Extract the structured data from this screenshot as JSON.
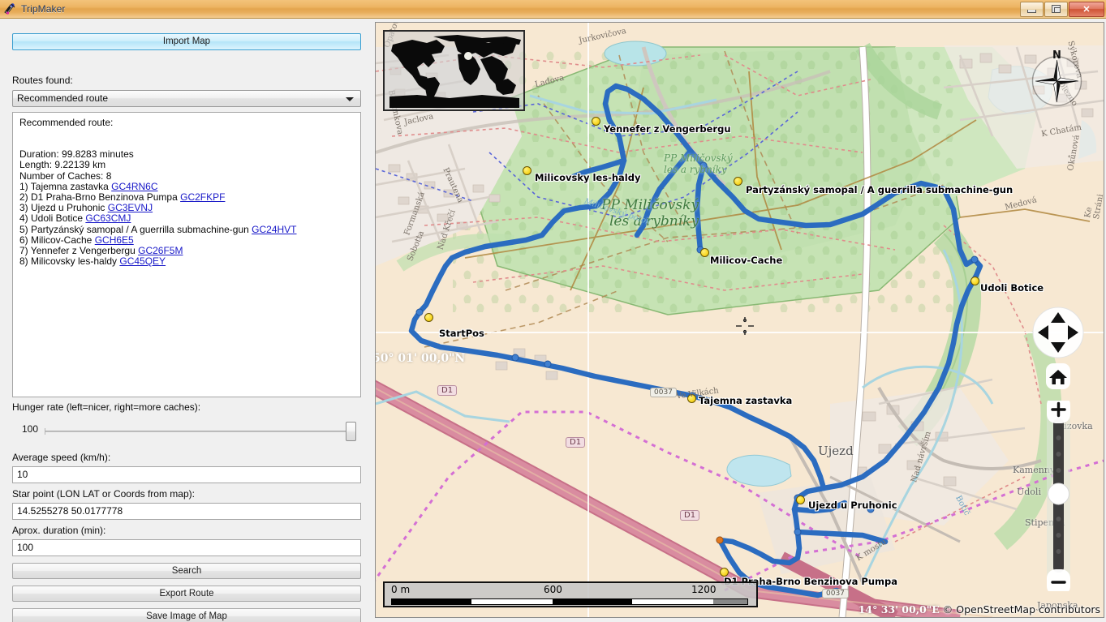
{
  "window": {
    "title": "TripMaker",
    "icon": "app-icon",
    "buttons": {
      "minimize": "minimize",
      "restore": "restore",
      "close": "close"
    }
  },
  "panel": {
    "import_label": "Import Map",
    "routes_found_label": "Routes found:",
    "route_select_value": "Recommended route",
    "route_select_options": [
      "Recommended route"
    ],
    "details": {
      "title": "Recommended route:",
      "duration": "Duration: 99.8283 minutes",
      "length": "Length: 9.22139 km",
      "num_caches": "Number of Caches: 8",
      "caches": [
        {
          "index": "1)",
          "name": "Tajemna zastavka",
          "code": "GC4RN6C"
        },
        {
          "index": "2)",
          "name": "D1 Praha-Brno Benzinova Pumpa",
          "code": "GC2FKPF"
        },
        {
          "index": "3)",
          "name": "Ujezd u Pruhonic",
          "code": "GC3EVNJ"
        },
        {
          "index": "4)",
          "name": "Udoli Botice",
          "code": "GC63CMJ"
        },
        {
          "index": "5)",
          "name": "Partyzánský samopal / A guerrilla submachine-gun",
          "code": "GC24HVT"
        },
        {
          "index": "6)",
          "name": "Milicov-Cache",
          "code": "GCH6E5"
        },
        {
          "index": "7)",
          "name": "Yennefer z Vengerbergu",
          "code": "GC26F5M"
        },
        {
          "index": "8)",
          "name": "Milicovsky les-haldy",
          "code": "GC45QEY"
        }
      ]
    },
    "hunger_label": "Hunger rate (left=nicer, right=more caches):",
    "hunger_value": "100",
    "speed_label": "Average speed (km/h):",
    "speed_value": "10",
    "startpoint_label": "Star point (LON LAT or Coords from map):",
    "startpoint_value": "14.5255278 50.0177778",
    "duration_label": "Aprox. duration (min):",
    "duration_value": "100",
    "search_label": "Search",
    "export_label": "Export Route",
    "saveimage_label": "Save Image of Map"
  },
  "map": {
    "compass_north": "N",
    "attribution": "© OpenStreetMap contributors",
    "grid_labels": [
      {
        "text": "50° 01' 00,0\"N"
      },
      {
        "text": "14° 33' 00,0\"E"
      }
    ],
    "scalebar": {
      "ticks": [
        "0 m",
        "600",
        "1200"
      ]
    },
    "markers": [
      {
        "name": "Yennefer z Vengerbergu"
      },
      {
        "name": "Milicovsky les-haldy"
      },
      {
        "name": "Partyzánský samopal / A guerrilla submachine-gun"
      },
      {
        "name": "Milicov-Cache"
      },
      {
        "name": "Udoli Botice"
      },
      {
        "name": "StartPos"
      },
      {
        "name": "Tajemna zastavka"
      },
      {
        "name": "Ujezd u Pruhonic"
      },
      {
        "name": "D1 Praha-Brno Benzinova Pumpa"
      }
    ],
    "place_labels": [
      {
        "text": "PP Miličovský"
      },
      {
        "text": "les a rybníky"
      },
      {
        "text": "PP Miličovský"
      },
      {
        "text": "les a rybníky"
      },
      {
        "text": "Ujezd"
      },
      {
        "text": "Rizovka"
      },
      {
        "text": "Kamenny"
      },
      {
        "text": "Udoli"
      },
      {
        "text": "Stipenka"
      },
      {
        "text": "Japonska"
      },
      {
        "text": "Jurkovičova"
      },
      {
        "text": "Ladova"
      },
      {
        "text": "Jaclova"
      },
      {
        "text": "Prautena"
      },
      {
        "text": "Bohunkova"
      },
      {
        "text": "Formanská"
      },
      {
        "text": "Nad Křečí"
      },
      {
        "text": "Sobotta"
      },
      {
        "text": "K Chatám"
      },
      {
        "text": "Sýkorova"
      },
      {
        "text": "Medová"
      },
      {
        "text": "Botič"
      },
      {
        "text": "Nad návrším"
      },
      {
        "text": "K mostu"
      },
      {
        "text": "Ve Vilkách"
      },
      {
        "text": "Miličovský potok"
      },
      {
        "text": "Diezno"
      },
      {
        "text": "Ke Stráni"
      },
      {
        "text": "Okůnová"
      },
      {
        "text": "Opatov"
      }
    ],
    "road_shields": [
      "D1",
      "D1",
      "D1",
      "0037",
      "0037"
    ],
    "controls": {
      "pan": [
        "pan-up",
        "pan-left",
        "pan-right",
        "pan-down"
      ],
      "home": "home",
      "zoom_in": "+",
      "zoom_out": "−"
    }
  },
  "colors": {
    "title_bar": "#e8ae5c",
    "route_line": "#2a6fc4",
    "marker": "#f5d518",
    "park_green": "#c8e0b6",
    "land": "#f7e7cf",
    "motorway": "#d4798e",
    "link_blue": "#1818c8",
    "accent_button": "#b3e4f8"
  }
}
